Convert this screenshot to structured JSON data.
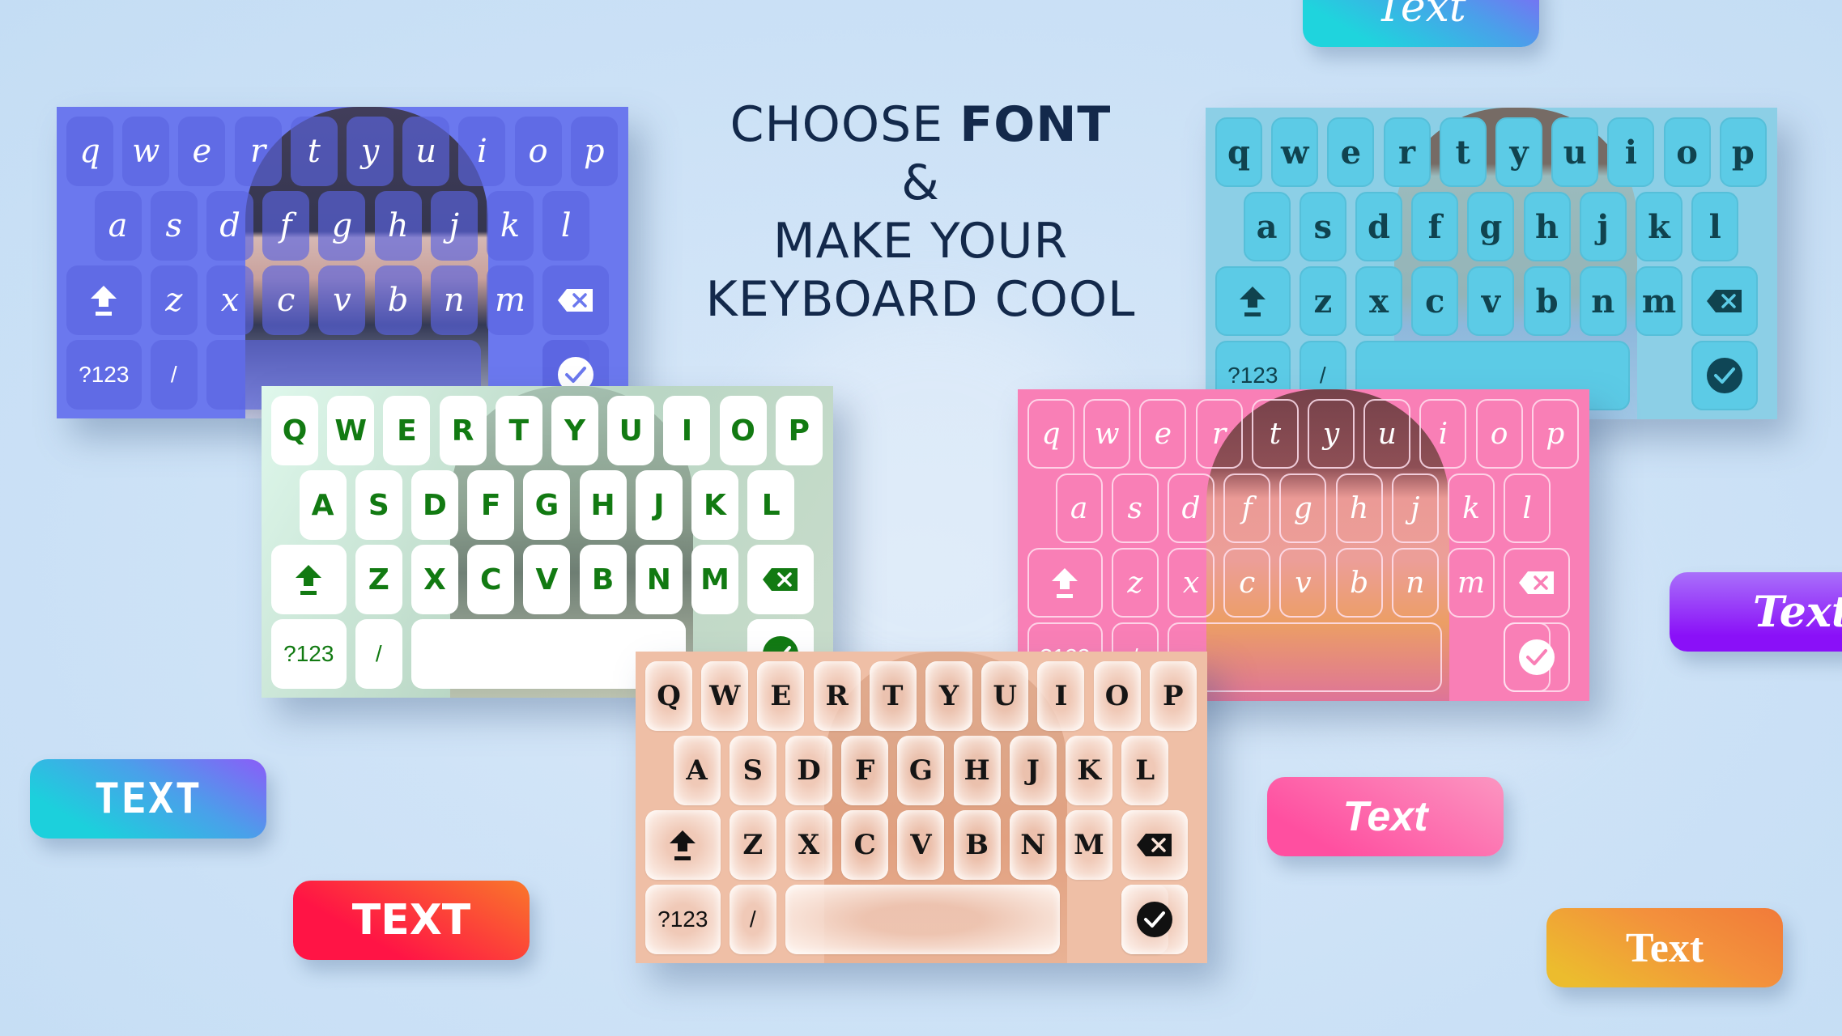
{
  "headline": {
    "line1_regular": "CHOOSE ",
    "line1_bold": "FONT",
    "line2": "&",
    "line3": "MAKE YOUR",
    "line4": "KEYBOARD COOL",
    "color": "#13294b"
  },
  "keyboards": [
    {
      "id": "blue",
      "theme_color": "#6b78ee",
      "font_style": "script",
      "rows": [
        [
          "q",
          "w",
          "e",
          "r",
          "t",
          "y",
          "u",
          "i",
          "o",
          "p"
        ],
        [
          "a",
          "s",
          "d",
          "f",
          "g",
          "h",
          "j",
          "k",
          "l"
        ],
        [
          "z",
          "x",
          "c",
          "v",
          "b",
          "n",
          "m"
        ]
      ],
      "shift_icon": "shift-icon",
      "backspace_icon": "backspace-icon",
      "symbols_label": "?123",
      "slash_label": "/",
      "period_label": ".",
      "enter_icon": "check-circle-icon"
    },
    {
      "id": "teal",
      "theme_color": "#5ccbe6",
      "font_style": "decorative-serif",
      "rows": [
        [
          "q",
          "w",
          "e",
          "r",
          "t",
          "y",
          "u",
          "i",
          "o",
          "p"
        ],
        [
          "a",
          "s",
          "d",
          "f",
          "g",
          "h",
          "j",
          "k",
          "l"
        ],
        [
          "z",
          "x",
          "c",
          "v",
          "b",
          "n",
          "m"
        ]
      ],
      "shift_icon": "shift-icon",
      "backspace_icon": "backspace-icon",
      "symbols_label": "?123",
      "slash_label": "/",
      "period_label": ".",
      "enter_icon": "check-circle-icon"
    },
    {
      "id": "green",
      "theme_color": "#127a12",
      "font_style": "bubble",
      "rows": [
        [
          "Q",
          "W",
          "E",
          "R",
          "T",
          "Y",
          "U",
          "I",
          "O",
          "P"
        ],
        [
          "A",
          "S",
          "D",
          "F",
          "G",
          "H",
          "J",
          "K",
          "L"
        ],
        [
          "Z",
          "X",
          "C",
          "V",
          "B",
          "N",
          "M"
        ]
      ],
      "shift_icon": "shift-icon",
      "backspace_icon": "backspace-icon",
      "symbols_label": "?123",
      "slash_label": "/",
      "period_label": ".",
      "enter_icon": "check-circle-icon"
    },
    {
      "id": "pink",
      "theme_color": "#f97fb6",
      "font_style": "handwritten",
      "rows": [
        [
          "q",
          "w",
          "e",
          "r",
          "t",
          "y",
          "u",
          "i",
          "o",
          "p"
        ],
        [
          "a",
          "s",
          "d",
          "f",
          "g",
          "h",
          "j",
          "k",
          "l"
        ],
        [
          "z",
          "x",
          "c",
          "v",
          "b",
          "n",
          "m"
        ]
      ],
      "shift_icon": "shift-icon",
      "backspace_icon": "backspace-icon",
      "symbols_label": "?123",
      "slash_label": "/",
      "period_label": ".",
      "enter_icon": "check-circle-icon"
    },
    {
      "id": "peach",
      "theme_color": "#efbfa6",
      "font_style": "shadow-caps",
      "rows": [
        [
          "Q",
          "W",
          "E",
          "R",
          "T",
          "Y",
          "U",
          "I",
          "O",
          "P"
        ],
        [
          "A",
          "S",
          "D",
          "F",
          "G",
          "H",
          "J",
          "K",
          "L"
        ],
        [
          "Z",
          "X",
          "C",
          "V",
          "B",
          "N",
          "M"
        ]
      ],
      "shift_icon": "shift-icon",
      "backspace_icon": "backspace-icon",
      "symbols_label": "?123",
      "slash_label": "/",
      "period_label": ".",
      "enter_icon": "check-circle-icon"
    }
  ],
  "badges": [
    {
      "id": "top",
      "label": "Text",
      "colors": [
        "#1fd4dd",
        "#8b5cf8"
      ]
    },
    {
      "id": "purple",
      "label": "Text",
      "colors": [
        "#a970fa",
        "#8a10f8"
      ]
    },
    {
      "id": "cyan",
      "label": "TEXT",
      "colors": [
        "#1cd0dc",
        "#8b5cf8"
      ]
    },
    {
      "id": "red",
      "label": "TEXT",
      "colors": [
        "#ff1445",
        "#f9782a"
      ]
    },
    {
      "id": "pink",
      "label": "Text",
      "colors": [
        "#ff4fa0",
        "#fb96c1"
      ]
    },
    {
      "id": "orange",
      "label": "Text",
      "colors": [
        "#ecbc2e",
        "#f17a39"
      ]
    }
  ]
}
